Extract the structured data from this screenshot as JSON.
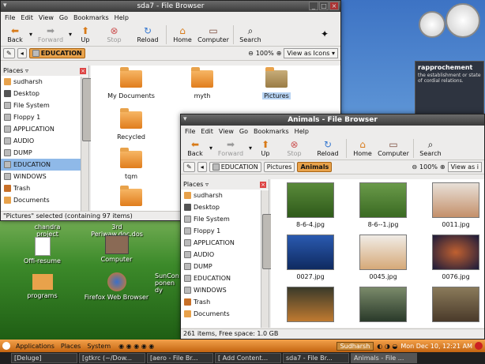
{
  "desktop": {
    "icons": [
      {
        "label": "chandra project"
      },
      {
        "label": "3rd Periwaw.doc.dos"
      },
      {
        "label": "Offi-resume"
      },
      {
        "label": "Computer"
      },
      {
        "label": "programs"
      },
      {
        "label": "Firefox Web Browser"
      },
      {
        "label": "SunCon ponen dy"
      }
    ],
    "dictionary": {
      "word": "rapprochement",
      "definition": "the establishment or state of cordial relations."
    }
  },
  "window1": {
    "title": "sda7 - File Browser",
    "menu": [
      "File",
      "Edit",
      "View",
      "Go",
      "Bookmarks",
      "Help"
    ],
    "toolbar": {
      "back": "Back",
      "forward": "Forward",
      "up": "Up",
      "stop": "Stop",
      "reload": "Reload",
      "home": "Home",
      "computer": "Computer",
      "search": "Search"
    },
    "location": {
      "crumb": "EDUCATION",
      "zoom": "100%",
      "view": "View as Icons"
    },
    "places_label": "Places",
    "places": [
      "sudharsh",
      "Desktop",
      "File System",
      "Floppy 1",
      "APPLICATION",
      "AUDIO",
      "DUMP",
      "EDUCATION",
      "WINDOWS",
      "Trash",
      "Documents"
    ],
    "items": [
      "My Documents",
      "myth",
      "Pictures",
      "Recycled",
      "tqm",
      ""
    ],
    "status": "\"Pictures\" selected (containing 97 items)"
  },
  "window2": {
    "title": "Animals - File Browser",
    "menu": [
      "File",
      "Edit",
      "View",
      "Go",
      "Bookmarks",
      "Help"
    ],
    "toolbar": {
      "back": "Back",
      "forward": "Forward",
      "up": "Up",
      "stop": "Stop",
      "reload": "Reload",
      "home": "Home",
      "computer": "Computer",
      "search": "Search"
    },
    "location": {
      "crumbs": [
        "EDUCATION",
        "Pictures",
        "Animals"
      ],
      "zoom": "100%",
      "view": "View as i"
    },
    "places_label": "Places",
    "places": [
      "sudharsh",
      "Desktop",
      "File System",
      "Floppy 1",
      "APPLICATION",
      "AUDIO",
      "DUMP",
      "EDUCATION",
      "WINDOWS",
      "Trash",
      "Documents"
    ],
    "files": [
      "8-6-4.jpg",
      "8-6--1.jpg",
      "0011.jpg",
      "0027.jpg",
      "0045.jpg",
      "0076.jpg",
      "",
      "",
      ""
    ],
    "status": "261 items, Free space: 1.0 GB"
  },
  "topbar": {
    "menus": [
      "Applications",
      "Places",
      "System"
    ],
    "user": "Sudharsh",
    "clock": "Mon Dec 10, 12:21 AM"
  },
  "taskbar": [
    "[Deluge]",
    "[gtkrc (~/Dow...",
    "[aero - File Br...",
    "[ Add Content...",
    "sda7 - File Br...",
    "Animals - File ..."
  ]
}
